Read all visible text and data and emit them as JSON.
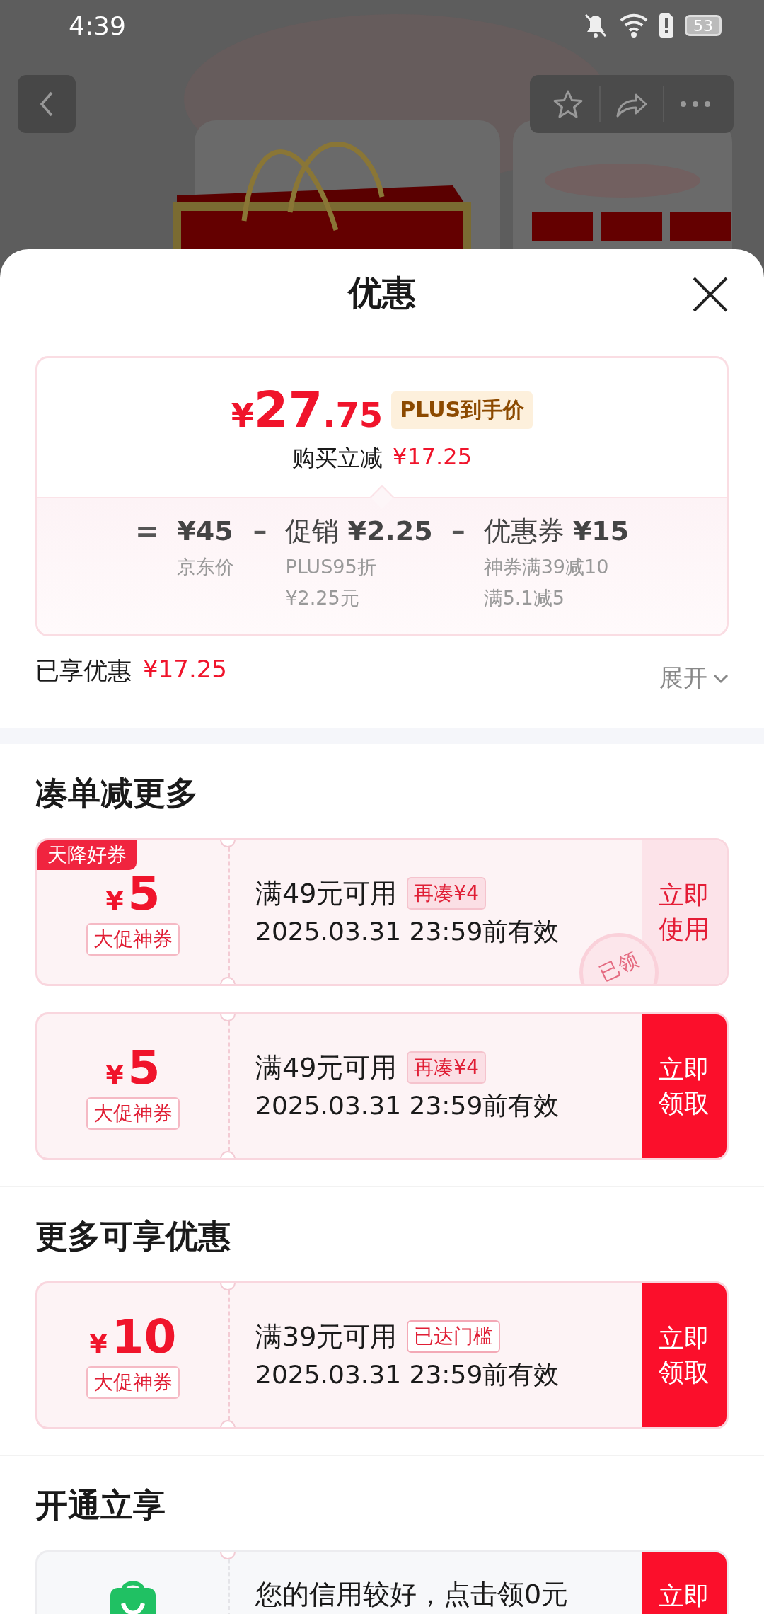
{
  "status_bar": {
    "time": "4:39",
    "battery": "53"
  },
  "sheet": {
    "title": "优惠"
  },
  "price_card": {
    "currency": "¥",
    "integer": "27",
    "decimal": ".75",
    "badge": "PLUS到手价",
    "saving_label": "购买立减",
    "saving_amount": "¥17.25",
    "breakdown": [
      {
        "operator": "=",
        "amount": "¥45",
        "notes": [
          "京东价"
        ]
      },
      {
        "operator": "–",
        "label": "促销",
        "amount": "¥2.25",
        "notes": [
          "PLUS95折",
          "¥2.25元"
        ]
      },
      {
        "operator": "–",
        "label": "优惠券",
        "amount": "¥15",
        "notes": [
          "神券满39减10",
          "满5.1减5"
        ]
      }
    ]
  },
  "summary": {
    "label": "已享优惠",
    "amount": "¥17.25",
    "expand": "展开",
    "expanded": false
  },
  "sections": [
    {
      "title": "凑单减更多",
      "offers": [
        {
          "kind": "coupon",
          "tag": "天降好券",
          "currency": "¥",
          "amount": "5",
          "type": "大促神券",
          "condition": "满49元可用",
          "hint": "再凑¥4",
          "threshold_met": false,
          "validity": "2025.03.31 23:59前有效",
          "stamp": "已领",
          "action": "立即使用",
          "claimed": true
        },
        {
          "kind": "coupon",
          "currency": "¥",
          "amount": "5",
          "type": "大促神券",
          "condition": "满49元可用",
          "hint": "再凑¥4",
          "threshold_met": false,
          "validity": "2025.03.31 23:59前有效",
          "action": "立即领取",
          "claimed": false
        }
      ]
    },
    {
      "title": "更多可享优惠",
      "offers": [
        {
          "kind": "coupon",
          "currency": "¥",
          "amount": "10",
          "type": "大促神券",
          "condition": "满39元可用",
          "hint": "已达门槛",
          "threshold_met": true,
          "validity": "2025.03.31 23:59前有效",
          "action": "立即领取",
          "claimed": false
        }
      ]
    },
    {
      "title": "开通立享",
      "offers": [
        {
          "kind": "service",
          "message": "您的信用较好，点击领0元",
          "action": "立即",
          "claimed": false
        }
      ]
    }
  ]
}
